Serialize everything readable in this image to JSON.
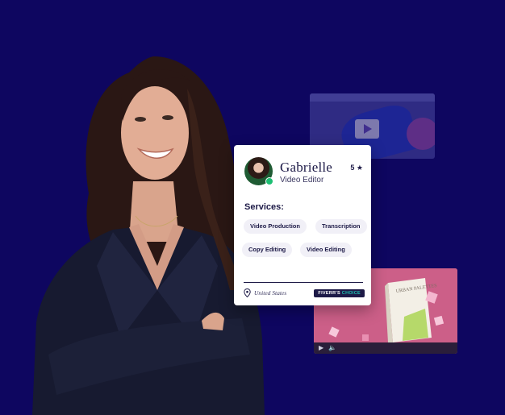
{
  "card": {
    "name": "Gabrielle",
    "title": "Video Editor",
    "rating": "5 ★",
    "status": "online",
    "services_label": "Services:",
    "services": [
      "Video Production",
      "Transcription",
      "Copy Editing",
      "Video Editing"
    ],
    "location": "United States",
    "badge_prefix": "FIVERR'S",
    "badge_suffix": "CHOICE"
  },
  "colors": {
    "background": "#0e0660",
    "card": "#ffffff",
    "text_dark": "#1d1a47",
    "online": "#1dbf73",
    "badge_accent": "#1dbfb0",
    "player_pink": "#c05c8a"
  },
  "icons": {
    "location": "map-pin-icon",
    "play": "play-icon",
    "volume": "volume-icon"
  },
  "player": {
    "book_text": "URBAN PALETTES"
  }
}
